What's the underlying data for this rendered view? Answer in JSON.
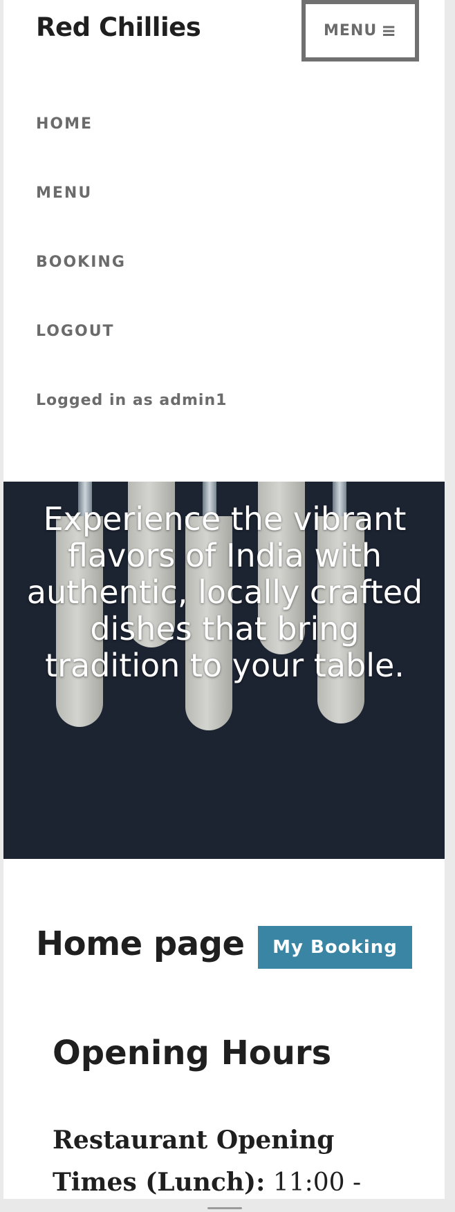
{
  "header": {
    "site_title": "Red Chillies",
    "menu_toggle_label": "MENU",
    "menu_toggle_icon": "hamburger-icon"
  },
  "nav": {
    "items": [
      {
        "label": "HOME"
      },
      {
        "label": "MENU"
      },
      {
        "label": "BOOKING"
      },
      {
        "label": "LOGOUT"
      }
    ],
    "logged_in_text": "Logged in as admin1"
  },
  "hero": {
    "text": "Experience the vibrant flavors of India with authentic, locally crafted dishes that bring tradition to your table."
  },
  "main": {
    "page_title": "Home page",
    "booking_button_label": "My Booking",
    "section_title": "Opening Hours",
    "hours_label": "Restaurant Opening Times (Lunch):",
    "hours_value": "11:00 -"
  },
  "colors": {
    "accent": "#3a85a4",
    "hero_background": "#1c2331",
    "nav_text": "#6b6b6b"
  }
}
